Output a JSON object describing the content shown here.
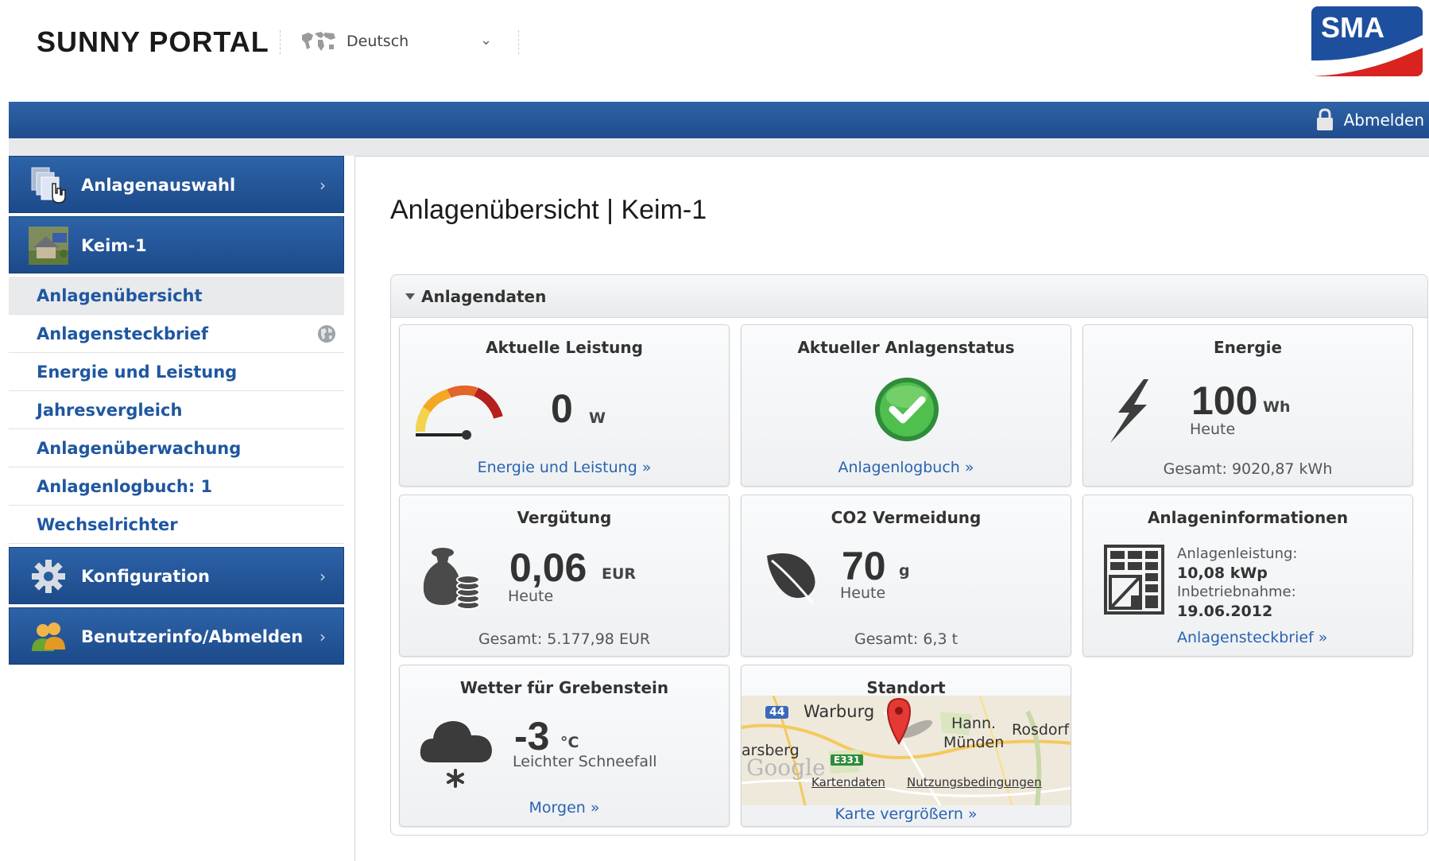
{
  "header": {
    "brand": "SUNNY PORTAL",
    "language": "Deutsch",
    "logo_text": "SMA"
  },
  "topbar": {
    "logout_label": "Abmelden"
  },
  "sidebar": {
    "plant_select": "Anlagenauswahl",
    "plant_name": "Keim-1",
    "sub_items": [
      {
        "label": "Anlagenübersicht"
      },
      {
        "label": "Anlagensteckbrief"
      },
      {
        "label": "Energie und Leistung"
      },
      {
        "label": "Jahresvergleich"
      },
      {
        "label": "Anlagenüberwachung"
      },
      {
        "label": "Anlagenlogbuch: 1"
      },
      {
        "label": "Wechselrichter"
      }
    ],
    "config": "Konfiguration",
    "userinfo": "Benutzerinfo/Abmelden"
  },
  "content": {
    "title": "Anlagenübersicht | Keim-1",
    "panel_title": "Anlagendaten"
  },
  "tiles": {
    "leistung": {
      "title": "Aktuelle Leistung",
      "value": "0",
      "unit": "W",
      "link": "Energie und Leistung »"
    },
    "status": {
      "title": "Aktueller Anlagenstatus",
      "link": "Anlagenlogbuch »"
    },
    "energie": {
      "title": "Energie",
      "value": "100",
      "unit": "Wh",
      "period": "Heute",
      "total": "Gesamt: 9020,87 kWh"
    },
    "verguetung": {
      "title": "Vergütung",
      "value": "0,06",
      "unit": "EUR",
      "period": "Heute",
      "total": "Gesamt: 5.177,98 EUR"
    },
    "co2": {
      "title": "CO2 Vermeidung",
      "value": "70",
      "unit": "g",
      "period": "Heute",
      "total": "Gesamt: 6,3 t"
    },
    "info": {
      "title": "Anlageninformationen",
      "power_label": "Anlagenleistung:",
      "power_value": "10,08 kWp",
      "date_label": "Inbetriebnahme:",
      "date_value": "19.06.2012",
      "link": "Anlagensteckbrief »"
    },
    "wetter": {
      "title": "Wetter für Grebenstein",
      "value": "-3",
      "unit": "°C",
      "desc": "Leichter Schneefall",
      "link": "Morgen »"
    },
    "standort": {
      "title": "Standort",
      "link": "Karte vergrößern »",
      "map_labels": {
        "warburg": "Warburg",
        "hann": "Hann.",
        "muenden": "Münden",
        "rosdorf": "Rosdorf",
        "arsberg": "arsberg",
        "road_44": "44",
        "road_e331": "E331",
        "google": "Google",
        "attribution_1": "Kartendaten",
        "attribution_2": "Nutzungsbedingungen"
      }
    }
  },
  "colors": {
    "nav_blue": "#1f4c8d",
    "link_blue": "#2a63b0",
    "ok_green": "#35a845",
    "logo_red": "#d9231f"
  }
}
